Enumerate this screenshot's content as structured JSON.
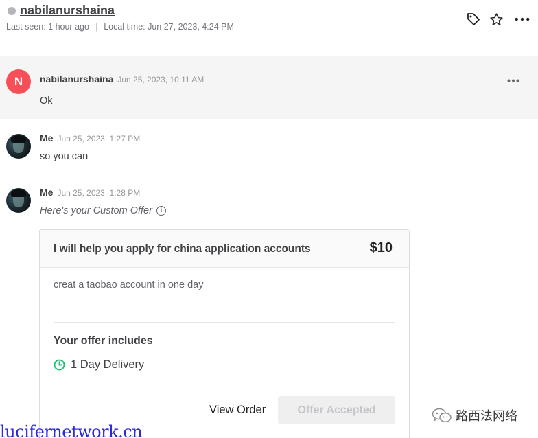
{
  "header": {
    "username": "nabilanurshaina",
    "last_seen": "Last seen: 1 hour ago",
    "local_time": "Local time: Jun 27, 2023, 4:24 PM",
    "status": "offline",
    "icons": [
      "tag-icon",
      "star-icon",
      "more-options-icon"
    ]
  },
  "messages": [
    {
      "sender": "nabilanurshaina",
      "avatar_letter": "N",
      "avatar_color": "#f74f57",
      "time": "Jun 25, 2023, 10:11 AM",
      "text": "Ok"
    },
    {
      "sender": "Me",
      "time": "Jun 25, 2023, 1:27 PM",
      "text": "so you can"
    },
    {
      "sender": "Me",
      "time": "Jun 25, 2023, 1:28 PM",
      "intro": "Here's your Custom Offer"
    }
  ],
  "offer": {
    "title": "I will help you apply for china application accounts",
    "price": "$10",
    "description": "creat a taobao account in one day",
    "includes_title": "Your offer includes",
    "delivery": "1 Day Delivery",
    "view_order": "View Order",
    "status_button": "Offer Accepted"
  },
  "watermark": {
    "site": "lucifernetwork.cn",
    "brand": "路西法网络"
  },
  "colors": {
    "accent_green": "#1dbf73",
    "avatar_red": "#f74f57",
    "watermark_blue": "#2a2ad6"
  }
}
